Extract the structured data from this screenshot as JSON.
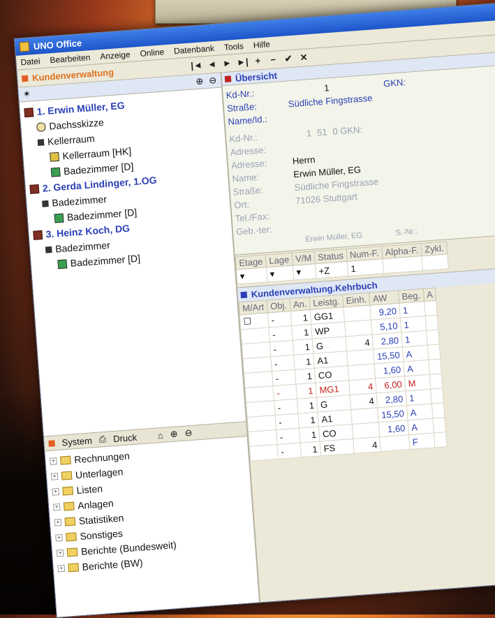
{
  "window": {
    "title": "UNO Office"
  },
  "menu": [
    "Datei",
    "Bearbeiten",
    "Anzeige",
    "Online",
    "Datenbank",
    "Tools",
    "Hilfe"
  ],
  "module_title": "Kundenverwaltung",
  "toolbar": [
    "|◄",
    "◄",
    "►",
    "►|",
    "+",
    "−",
    "✔",
    "✕"
  ],
  "tree": [
    {
      "label": "1. Erwin Müller, EG",
      "type": "customer",
      "children": [
        {
          "label": "Dachsskizze",
          "type": "sketch"
        },
        {
          "label": "Kellerraum",
          "type": "floor",
          "children": [
            {
              "label": "Kellerraum [HK]",
              "type": "roomhk"
            },
            {
              "label": "Badezimmer [D]",
              "type": "room"
            }
          ]
        }
      ]
    },
    {
      "label": "2. Gerda Lindinger, 1.OG",
      "type": "customer",
      "children": [
        {
          "label": "Badezimmer",
          "type": "floor",
          "children": [
            {
              "label": "Badezimmer [D]",
              "type": "room"
            }
          ]
        }
      ]
    },
    {
      "label": "3. Heinz Koch, DG",
      "type": "customer",
      "children": [
        {
          "label": "Badezimmer",
          "type": "floor",
          "children": [
            {
              "label": "Badezimmer [D]",
              "type": "room"
            }
          ]
        }
      ]
    }
  ],
  "system_panel": {
    "tab_system": "System",
    "tab_druck": "Druck",
    "folders": [
      "Rechnungen",
      "Unterlagen",
      "Listen",
      "Anlagen",
      "Statistiken",
      "Sonstiges",
      "Berichte (Bundesweit)",
      "Berichte (BW)"
    ]
  },
  "overview": {
    "title": "Übersicht",
    "kd_nr_label": "Kd-Nr.:",
    "kd_nr": "1",
    "gkn_label": "GKN:",
    "strasse_label": "Straße:",
    "strasse": "Südliche Fingstrasse",
    "name_label": "Name/Id.:",
    "sub_kd_nr_label": "Kd-Nr.:",
    "sub_kd_nr": "1",
    "sub_kd_num2": "51",
    "sub_gkn": "0 GKN:",
    "adresse_label": "Adresse:",
    "adresse2_label": "Adresse:",
    "adresse2": "Herrn",
    "name2_label": "Name:",
    "name2": "Erwin Müller, EG",
    "strasse2_label": "Straße:",
    "strasse2": "Südliche Fingstrasse",
    "ort_label": "Ort:",
    "ort": "71026 Stuttgart",
    "tel_label": "Tel./Fax:",
    "geb_label": "Geb.-ter:",
    "footer_name": "Erwin Müller, EG",
    "footer_snr": "S.-Nr.:"
  },
  "filter": {
    "headers": [
      "Etage",
      "Lage",
      "V/M",
      "Status",
      "Num-F.",
      "Alpha-F.",
      "Zykl."
    ],
    "status": "+Z",
    "num": "1"
  },
  "kehrbuch": {
    "title": "Kundenverwaltung.Kehrbuch",
    "columns": [
      "M/Art",
      "Obj.",
      "An.",
      "Leistg.",
      "Einh.",
      "AW",
      "Beg.",
      "A"
    ],
    "rows": [
      {
        "obj": "-",
        "an": "1",
        "leistg": "GG1",
        "einh": "",
        "aw": "9,20",
        "beg": "1",
        "hl": false
      },
      {
        "obj": "-",
        "an": "1",
        "leistg": "WP",
        "einh": "",
        "aw": "5,10",
        "beg": "1",
        "hl": false
      },
      {
        "obj": "-",
        "an": "1",
        "leistg": "G",
        "einh": "4",
        "aw": "2,80",
        "beg": "1",
        "hl": false
      },
      {
        "obj": "-",
        "an": "1",
        "leistg": "A1",
        "einh": "",
        "aw": "15,50",
        "beg": "A",
        "hl": false
      },
      {
        "obj": "-",
        "an": "1",
        "leistg": "CO",
        "einh": "",
        "aw": "1,60",
        "beg": "A",
        "hl": false
      },
      {
        "obj": "-",
        "an": "1",
        "leistg": "MG1",
        "einh": "4",
        "aw": "6,00",
        "beg": "M",
        "hl": true
      },
      {
        "obj": "-",
        "an": "1",
        "leistg": "G",
        "einh": "4",
        "aw": "2,80",
        "beg": "1",
        "hl": false
      },
      {
        "obj": "-",
        "an": "1",
        "leistg": "A1",
        "einh": "",
        "aw": "15,50",
        "beg": "A",
        "hl": false
      },
      {
        "obj": "-",
        "an": "1",
        "leistg": "CO",
        "einh": "",
        "aw": "1,60",
        "beg": "A",
        "hl": false
      },
      {
        "obj": "-",
        "an": "1",
        "leistg": "FS",
        "einh": "4",
        "aw": "",
        "beg": "F",
        "hl": false
      }
    ]
  }
}
